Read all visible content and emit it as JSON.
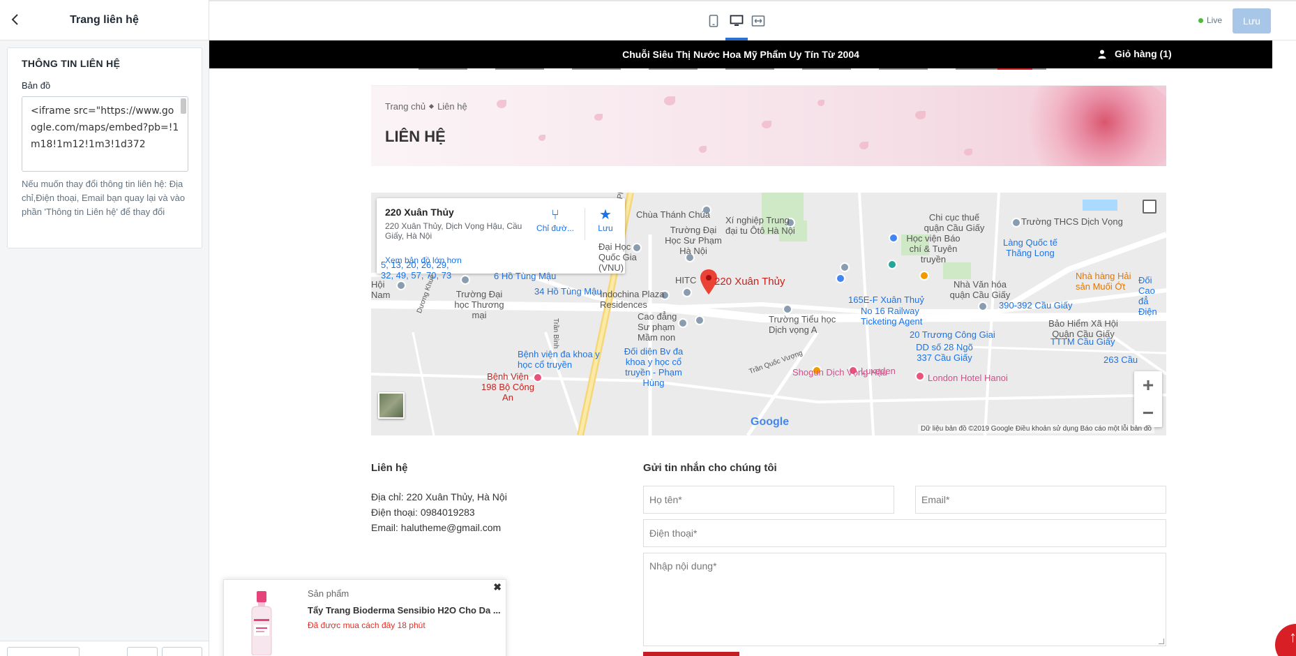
{
  "editor": {
    "header_title": "Trang liên hệ",
    "section_title": "THÔNG TIN LIÊN HỆ",
    "map_label": "Bản đồ",
    "map_value": "<iframe src=\"https://www.google.com/maps/embed?pb=!1m18!1m12!1m3!1d372",
    "help_text": "Nếu muốn thay đổi thông tin liên hệ: Địa chỉ,Điện thoại, Email bạn quay lại và vào phần 'Thông tin Liên hệ' để thay đổi"
  },
  "toolbar": {
    "devices": [
      "mobile-icon",
      "desktop-icon",
      "fullwidth-icon"
    ],
    "active_device": "desktop",
    "live_label": "Live",
    "save_label": "Lưu"
  },
  "site": {
    "topbar_text": "Chuỗi Siêu Thị Nước Hoa Mỹ Phẩm Uy Tín Từ 2004",
    "cart_label": "Giỏ hàng (1)",
    "breadcrumb": [
      "Trang chủ",
      "Liên hệ"
    ],
    "page_title": "LIÊN HỆ"
  },
  "map": {
    "place_name": "220 Xuân Thủy",
    "place_address": "220 Xuân Thủy, Dịch Vọng Hậu, Cầu Giấy, Hà Nội",
    "directions_label": "Chỉ đườ...",
    "save_label": "Lưu",
    "larger_map_link": "Xem bản đồ lớn hơn",
    "marker_label": "220 Xuân Thủy",
    "google_logo": "Google",
    "footer_text": "Dữ liệu bản đồ ©2019 Google   Điều khoản sử dụng   Báo cáo một lỗi bản đồ",
    "labels_dark": {
      "chua": "Chùa Thánh Chúa",
      "xinghiep": "Xí nghiệp Trung đại tu Ôtô Hà Nội",
      "dhsp": "Trường Đại Học Sư Phạm Hà Nội",
      "dhqg": "Đại Học Quốc Gia (VNU)",
      "hitc": "HITC",
      "indochina": "Indochina Plaza Residences",
      "cdsp": "Cao đẳng Sư phạm Mầm non",
      "tieuhoc": "Trường Tiểu học Dịch vọng A",
      "dhtm": "Trường Đại học Thương mại",
      "hocvien": "Học viện Báo chí & Tuyên truyền",
      "thcs": "Trường THCS Dịch Vọng",
      "chicuc": "Chi cục thuế quận Cầu Giấy",
      "nhavanhoa": "Nhà Văn hóa quận Cầu Giấy",
      "baohiem": "Bảo Hiểm Xã Hội Quận Cầu Giấy",
      "hoinam": "Hội Nam",
      "phamhung": "Phạm Hùng",
      "tranquocvuong": "Trần Quốc Vượng",
      "tranbinh": "Trần Bình",
      "duongkhue": "Dương Khuê"
    },
    "labels_blue": {
      "bus1": "5, 13, 20, 26, 29, 32, 49, 57, 70, 73",
      "tungmau6": "6 Hồ Tùng Mậu",
      "tungmau34": "34 Hồ Tùng Mậu",
      "xuanthuy": "165E-F Xuân Thuỷ",
      "railway": "No 16 Railway Ticketing Agent",
      "truongcong": "20 Trương Công Giai",
      "ngo": "DD số 28 Ngõ 337 Cầu Giấy",
      "caugiay390": "390-392 Cầu Giấy",
      "ttm": "TTTM Cầu Giấy",
      "langquocte": "Làng Quốc tế Thăng Long",
      "bvdakhoa": "Bệnh viện đa khoa y học cổ truyền",
      "doidien": "Đối diện Bv đa khoa y học cổ truyền - Phạm Hùng",
      "cau263": "263 Cầu"
    },
    "labels_red": {
      "bv198": "Bệnh Viện 198 Bộ Công An"
    },
    "labels_pink": {
      "luxeden": "Luxeden",
      "shogun": "Shogun Dịch Vọng Hậu",
      "london": "London Hotel Hanoi",
      "nhahang": "Nhà hàng Hải sản Muối Ớt",
      "doicao": "Đối Cao đẳ Điện"
    }
  },
  "contact": {
    "title": "Liên hệ",
    "address": "Địa chỉ: 220 Xuân Thủy, Hà Nội",
    "phone": "Điện thoại: 0984019283",
    "email": "Email: halutheme@gmail.com"
  },
  "form": {
    "title": "Gửi tin nhắn cho chúng tôi",
    "name_placeholder": "Họ tên*",
    "email_placeholder": "Email*",
    "phone_placeholder": "Điện thoại*",
    "message_placeholder": "Nhập nội dung*"
  },
  "popup": {
    "label": "Sản phẩm",
    "product_name": "Tẩy Trang Bioderma Sensibio H2O Cho Da ...",
    "time_text": "Đã được mua cách đây 18 phút"
  },
  "colors": {
    "accent_blue": "#2c6ecb",
    "brand_red": "#d81f26",
    "live_green": "#50b83c"
  }
}
